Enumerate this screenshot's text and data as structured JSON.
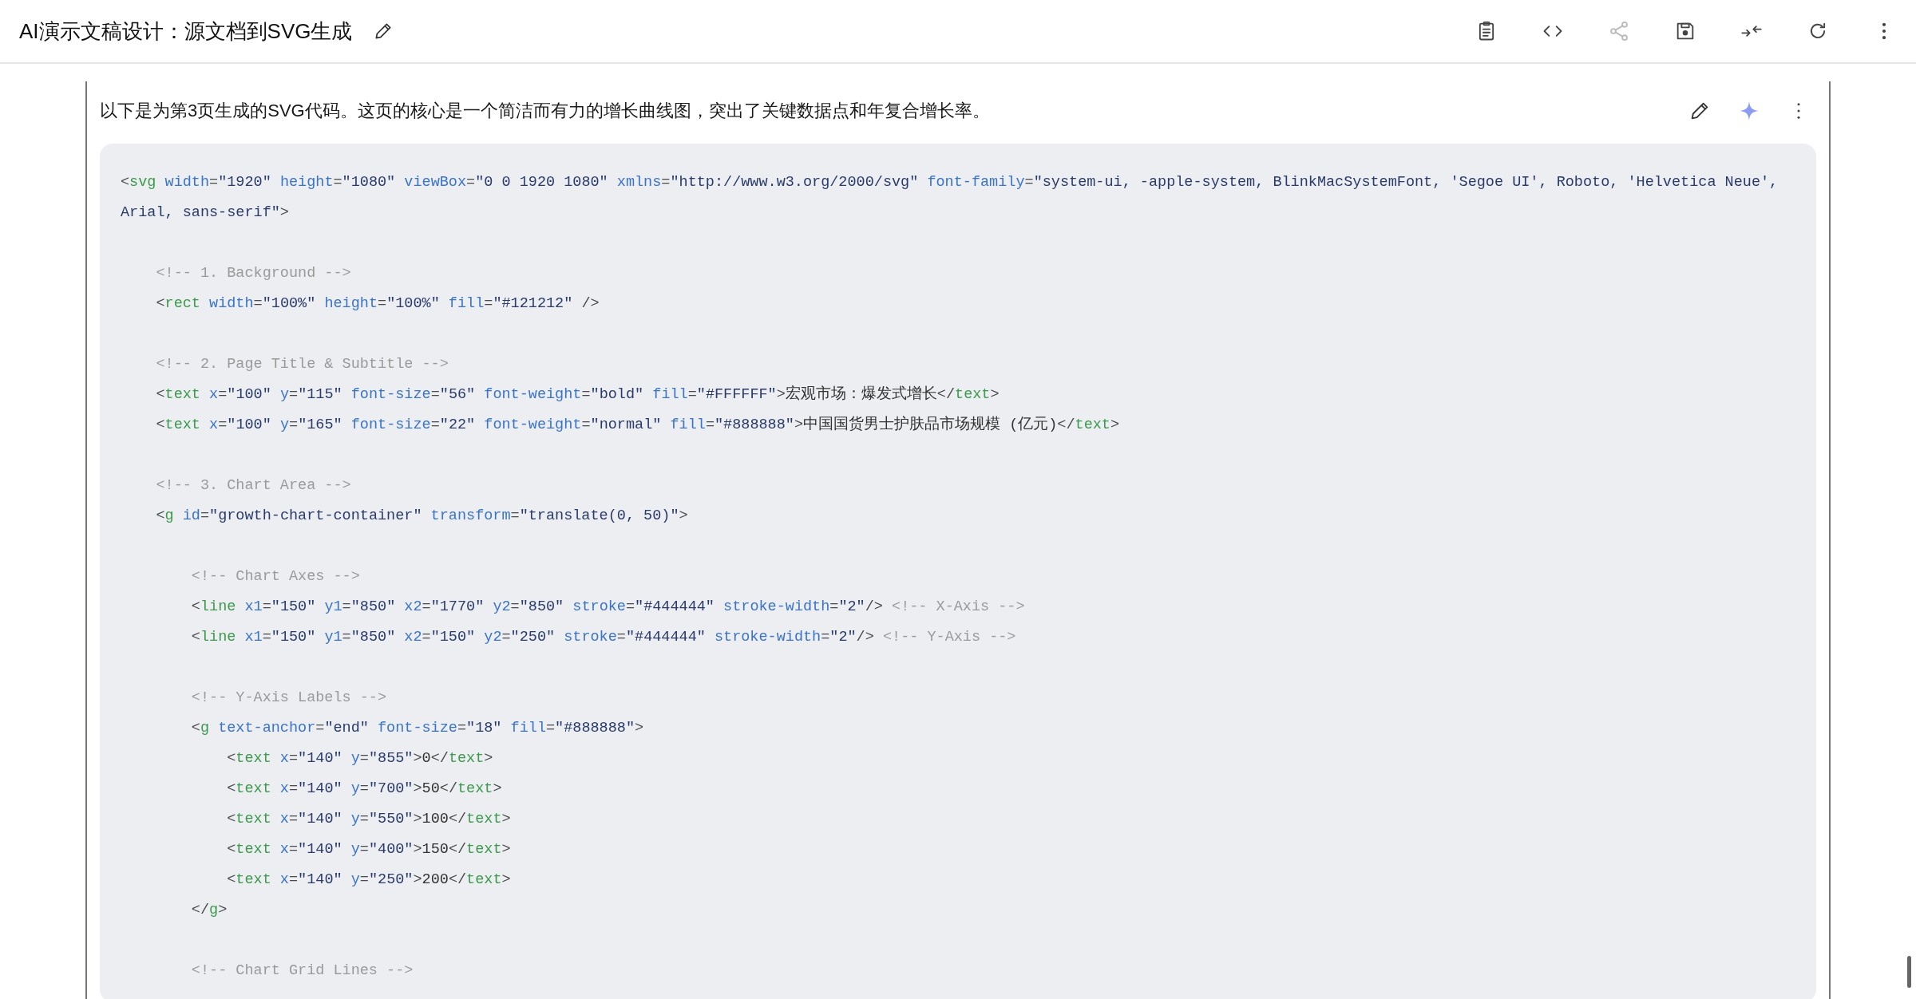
{
  "header": {
    "title": "AI演示文稿设计：源文档到SVG生成",
    "toolbar": [
      {
        "kind": "clipboard",
        "disabled": false
      },
      {
        "kind": "code",
        "disabled": false
      },
      {
        "kind": "share",
        "disabled": true
      },
      {
        "kind": "save",
        "disabled": false
      },
      {
        "kind": "collapse",
        "disabled": false
      },
      {
        "kind": "refresh",
        "disabled": false
      },
      {
        "kind": "more",
        "disabled": false
      }
    ]
  },
  "message": {
    "text": "以下是为第3页生成的SVG代码。这页的核心是一个简洁而有力的增长曲线图，突出了关键数据点和年复合增长率。",
    "actions": [
      {
        "kind": "edit"
      },
      {
        "kind": "sparkle"
      },
      {
        "kind": "more"
      }
    ],
    "code_blocks": [
      {
        "lines": [
          [
            {
              "kind": "p",
              "text": "<"
            },
            {
              "kind": "tag",
              "text": "svg"
            },
            {
              "kind": "attr",
              "text": " width"
            },
            {
              "kind": "p",
              "text": "="
            },
            {
              "kind": "val",
              "text": "\"1920\""
            },
            {
              "kind": "attr",
              "text": " height"
            },
            {
              "kind": "p",
              "text": "="
            },
            {
              "kind": "val",
              "text": "\"1080\""
            },
            {
              "kind": "attr",
              "text": " viewBox"
            },
            {
              "kind": "p",
              "text": "="
            },
            {
              "kind": "val",
              "text": "\"0 0 1920 1080\""
            },
            {
              "kind": "attr",
              "text": " xmlns"
            },
            {
              "kind": "p",
              "text": "="
            },
            {
              "kind": "val",
              "text": "\"http://www.w3.org/2000/svg\""
            },
            {
              "kind": "attr",
              "text": " font-family"
            },
            {
              "kind": "p",
              "text": "="
            },
            {
              "kind": "val",
              "text": "\"system-ui, -apple-system, BlinkMacSystemFont, 'Segoe UI', Roboto, 'Helvetica Neue', Arial, sans-serif\""
            },
            {
              "kind": "p",
              "text": ">"
            }
          ]
        ]
      },
      {
        "lines": [
          [
            {
              "kind": "cmt",
              "text": "    <!-- 1. Background -->"
            }
          ],
          [
            {
              "kind": "p",
              "text": "    <"
            },
            {
              "kind": "tag",
              "text": "rect"
            },
            {
              "kind": "attr",
              "text": " width"
            },
            {
              "kind": "p",
              "text": "="
            },
            {
              "kind": "val",
              "text": "\"100%\""
            },
            {
              "kind": "attr",
              "text": " height"
            },
            {
              "kind": "p",
              "text": "="
            },
            {
              "kind": "val",
              "text": "\"100%\""
            },
            {
              "kind": "attr",
              "text": " fill"
            },
            {
              "kind": "p",
              "text": "="
            },
            {
              "kind": "val",
              "text": "\"#121212\""
            },
            {
              "kind": "p",
              "text": " />"
            }
          ]
        ]
      },
      {
        "lines": [
          [
            {
              "kind": "cmt",
              "text": "    <!-- 2. Page Title & Subtitle -->"
            }
          ],
          [
            {
              "kind": "p",
              "text": "    <"
            },
            {
              "kind": "tag",
              "text": "text"
            },
            {
              "kind": "attr",
              "text": " x"
            },
            {
              "kind": "p",
              "text": "="
            },
            {
              "kind": "val",
              "text": "\"100\""
            },
            {
              "kind": "attr",
              "text": " y"
            },
            {
              "kind": "p",
              "text": "="
            },
            {
              "kind": "val",
              "text": "\"115\""
            },
            {
              "kind": "attr",
              "text": " font-size"
            },
            {
              "kind": "p",
              "text": "="
            },
            {
              "kind": "val",
              "text": "\"56\""
            },
            {
              "kind": "attr",
              "text": " font-weight"
            },
            {
              "kind": "p",
              "text": "="
            },
            {
              "kind": "val",
              "text": "\"bold\""
            },
            {
              "kind": "attr",
              "text": " fill"
            },
            {
              "kind": "p",
              "text": "="
            },
            {
              "kind": "val",
              "text": "\"#FFFFFF\""
            },
            {
              "kind": "p",
              "text": ">"
            },
            {
              "kind": "txt",
              "text": "宏观市场：爆发式增长"
            },
            {
              "kind": "p",
              "text": "</"
            },
            {
              "kind": "tag",
              "text": "text"
            },
            {
              "kind": "p",
              "text": ">"
            }
          ],
          [
            {
              "kind": "p",
              "text": "    <"
            },
            {
              "kind": "tag",
              "text": "text"
            },
            {
              "kind": "attr",
              "text": " x"
            },
            {
              "kind": "p",
              "text": "="
            },
            {
              "kind": "val",
              "text": "\"100\""
            },
            {
              "kind": "attr",
              "text": " y"
            },
            {
              "kind": "p",
              "text": "="
            },
            {
              "kind": "val",
              "text": "\"165\""
            },
            {
              "kind": "attr",
              "text": " font-size"
            },
            {
              "kind": "p",
              "text": "="
            },
            {
              "kind": "val",
              "text": "\"22\""
            },
            {
              "kind": "attr",
              "text": " font-weight"
            },
            {
              "kind": "p",
              "text": "="
            },
            {
              "kind": "val",
              "text": "\"normal\""
            },
            {
              "kind": "attr",
              "text": " fill"
            },
            {
              "kind": "p",
              "text": "="
            },
            {
              "kind": "val",
              "text": "\"#888888\""
            },
            {
              "kind": "p",
              "text": ">"
            },
            {
              "kind": "txt",
              "text": "中国国货男士护肤品市场规模 (亿元)"
            },
            {
              "kind": "p",
              "text": "</"
            },
            {
              "kind": "tag",
              "text": "text"
            },
            {
              "kind": "p",
              "text": ">"
            }
          ]
        ]
      },
      {
        "lines": [
          [
            {
              "kind": "cmt",
              "text": "    <!-- 3. Chart Area -->"
            }
          ],
          [
            {
              "kind": "p",
              "text": "    <"
            },
            {
              "kind": "tag",
              "text": "g"
            },
            {
              "kind": "attr",
              "text": " id"
            },
            {
              "kind": "p",
              "text": "="
            },
            {
              "kind": "val",
              "text": "\"growth-chart-container\""
            },
            {
              "kind": "attr",
              "text": " transform"
            },
            {
              "kind": "p",
              "text": "="
            },
            {
              "kind": "val",
              "text": "\"translate(0, 50)\""
            },
            {
              "kind": "p",
              "text": ">"
            }
          ]
        ]
      },
      {
        "lines": [
          [
            {
              "kind": "cmt",
              "text": "        <!-- Chart Axes -->"
            }
          ],
          [
            {
              "kind": "p",
              "text": "        <"
            },
            {
              "kind": "tag",
              "text": "line"
            },
            {
              "kind": "attr",
              "text": " x1"
            },
            {
              "kind": "p",
              "text": "="
            },
            {
              "kind": "val",
              "text": "\"150\""
            },
            {
              "kind": "attr",
              "text": " y1"
            },
            {
              "kind": "p",
              "text": "="
            },
            {
              "kind": "val",
              "text": "\"850\""
            },
            {
              "kind": "attr",
              "text": " x2"
            },
            {
              "kind": "p",
              "text": "="
            },
            {
              "kind": "val",
              "text": "\"1770\""
            },
            {
              "kind": "attr",
              "text": " y2"
            },
            {
              "kind": "p",
              "text": "="
            },
            {
              "kind": "val",
              "text": "\"850\""
            },
            {
              "kind": "attr",
              "text": " stroke"
            },
            {
              "kind": "p",
              "text": "="
            },
            {
              "kind": "val",
              "text": "\"#444444\""
            },
            {
              "kind": "attr",
              "text": " stroke-width"
            },
            {
              "kind": "p",
              "text": "="
            },
            {
              "kind": "val",
              "text": "\"2\""
            },
            {
              "kind": "p",
              "text": "/>"
            },
            {
              "kind": "cmt",
              "text": " <!-- X-Axis -->"
            }
          ],
          [
            {
              "kind": "p",
              "text": "        <"
            },
            {
              "kind": "tag",
              "text": "line"
            },
            {
              "kind": "attr",
              "text": " x1"
            },
            {
              "kind": "p",
              "text": "="
            },
            {
              "kind": "val",
              "text": "\"150\""
            },
            {
              "kind": "attr",
              "text": " y1"
            },
            {
              "kind": "p",
              "text": "="
            },
            {
              "kind": "val",
              "text": "\"850\""
            },
            {
              "kind": "attr",
              "text": " x2"
            },
            {
              "kind": "p",
              "text": "="
            },
            {
              "kind": "val",
              "text": "\"150\""
            },
            {
              "kind": "attr",
              "text": " y2"
            },
            {
              "kind": "p",
              "text": "="
            },
            {
              "kind": "val",
              "text": "\"250\""
            },
            {
              "kind": "attr",
              "text": " stroke"
            },
            {
              "kind": "p",
              "text": "="
            },
            {
              "kind": "val",
              "text": "\"#444444\""
            },
            {
              "kind": "attr",
              "text": " stroke-width"
            },
            {
              "kind": "p",
              "text": "="
            },
            {
              "kind": "val",
              "text": "\"2\""
            },
            {
              "kind": "p",
              "text": "/>"
            },
            {
              "kind": "cmt",
              "text": " <!-- Y-Axis -->"
            }
          ]
        ]
      },
      {
        "lines": [
          [
            {
              "kind": "cmt",
              "text": "        <!-- Y-Axis Labels -->"
            }
          ],
          [
            {
              "kind": "p",
              "text": "        <"
            },
            {
              "kind": "tag",
              "text": "g"
            },
            {
              "kind": "attr",
              "text": " text-anchor"
            },
            {
              "kind": "p",
              "text": "="
            },
            {
              "kind": "val",
              "text": "\"end\""
            },
            {
              "kind": "attr",
              "text": " font-size"
            },
            {
              "kind": "p",
              "text": "="
            },
            {
              "kind": "val",
              "text": "\"18\""
            },
            {
              "kind": "attr",
              "text": " fill"
            },
            {
              "kind": "p",
              "text": "="
            },
            {
              "kind": "val",
              "text": "\"#888888\""
            },
            {
              "kind": "p",
              "text": ">"
            }
          ],
          [
            {
              "kind": "p",
              "text": "            <"
            },
            {
              "kind": "tag",
              "text": "text"
            },
            {
              "kind": "attr",
              "text": " x"
            },
            {
              "kind": "p",
              "text": "="
            },
            {
              "kind": "val",
              "text": "\"140\""
            },
            {
              "kind": "attr",
              "text": " y"
            },
            {
              "kind": "p",
              "text": "="
            },
            {
              "kind": "val",
              "text": "\"855\""
            },
            {
              "kind": "p",
              "text": ">"
            },
            {
              "kind": "txt",
              "text": "0"
            },
            {
              "kind": "p",
              "text": "</"
            },
            {
              "kind": "tag",
              "text": "text"
            },
            {
              "kind": "p",
              "text": ">"
            }
          ],
          [
            {
              "kind": "p",
              "text": "            <"
            },
            {
              "kind": "tag",
              "text": "text"
            },
            {
              "kind": "attr",
              "text": " x"
            },
            {
              "kind": "p",
              "text": "="
            },
            {
              "kind": "val",
              "text": "\"140\""
            },
            {
              "kind": "attr",
              "text": " y"
            },
            {
              "kind": "p",
              "text": "="
            },
            {
              "kind": "val",
              "text": "\"700\""
            },
            {
              "kind": "p",
              "text": ">"
            },
            {
              "kind": "txt",
              "text": "50"
            },
            {
              "kind": "p",
              "text": "</"
            },
            {
              "kind": "tag",
              "text": "text"
            },
            {
              "kind": "p",
              "text": ">"
            }
          ],
          [
            {
              "kind": "p",
              "text": "            <"
            },
            {
              "kind": "tag",
              "text": "text"
            },
            {
              "kind": "attr",
              "text": " x"
            },
            {
              "kind": "p",
              "text": "="
            },
            {
              "kind": "val",
              "text": "\"140\""
            },
            {
              "kind": "attr",
              "text": " y"
            },
            {
              "kind": "p",
              "text": "="
            },
            {
              "kind": "val",
              "text": "\"550\""
            },
            {
              "kind": "p",
              "text": ">"
            },
            {
              "kind": "txt",
              "text": "100"
            },
            {
              "kind": "p",
              "text": "</"
            },
            {
              "kind": "tag",
              "text": "text"
            },
            {
              "kind": "p",
              "text": ">"
            }
          ],
          [
            {
              "kind": "p",
              "text": "            <"
            },
            {
              "kind": "tag",
              "text": "text"
            },
            {
              "kind": "attr",
              "text": " x"
            },
            {
              "kind": "p",
              "text": "="
            },
            {
              "kind": "val",
              "text": "\"140\""
            },
            {
              "kind": "attr",
              "text": " y"
            },
            {
              "kind": "p",
              "text": "="
            },
            {
              "kind": "val",
              "text": "\"400\""
            },
            {
              "kind": "p",
              "text": ">"
            },
            {
              "kind": "txt",
              "text": "150"
            },
            {
              "kind": "p",
              "text": "</"
            },
            {
              "kind": "tag",
              "text": "text"
            },
            {
              "kind": "p",
              "text": ">"
            }
          ],
          [
            {
              "kind": "p",
              "text": "            <"
            },
            {
              "kind": "tag",
              "text": "text"
            },
            {
              "kind": "attr",
              "text": " x"
            },
            {
              "kind": "p",
              "text": "="
            },
            {
              "kind": "val",
              "text": "\"140\""
            },
            {
              "kind": "attr",
              "text": " y"
            },
            {
              "kind": "p",
              "text": "="
            },
            {
              "kind": "val",
              "text": "\"250\""
            },
            {
              "kind": "p",
              "text": ">"
            },
            {
              "kind": "txt",
              "text": "200"
            },
            {
              "kind": "p",
              "text": "</"
            },
            {
              "kind": "tag",
              "text": "text"
            },
            {
              "kind": "p",
              "text": ">"
            }
          ],
          [
            {
              "kind": "p",
              "text": "        </"
            },
            {
              "kind": "tag",
              "text": "g"
            },
            {
              "kind": "p",
              "text": ">"
            }
          ]
        ]
      },
      {
        "lines": [
          [
            {
              "kind": "cmt",
              "text": "        <!-- Chart Grid Lines -->"
            }
          ]
        ]
      }
    ]
  }
}
